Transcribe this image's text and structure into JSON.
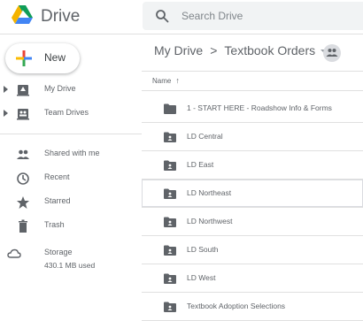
{
  "app": {
    "name": "Drive"
  },
  "search": {
    "placeholder": "Search Drive"
  },
  "sidebar": {
    "new_label": "New",
    "items": [
      {
        "label": "My Drive",
        "icon": "my-drive-icon",
        "expandable": true
      },
      {
        "label": "Team Drives",
        "icon": "team-drives-icon",
        "expandable": true
      },
      {
        "label": "Shared with me",
        "icon": "shared-with-me-icon"
      },
      {
        "label": "Recent",
        "icon": "recent-icon"
      },
      {
        "label": "Starred",
        "icon": "star-icon"
      },
      {
        "label": "Trash",
        "icon": "trash-icon"
      },
      {
        "label": "Storage",
        "icon": "cloud-icon"
      }
    ],
    "storage_used": "430.1 MB used"
  },
  "breadcrumb": {
    "root": "My Drive",
    "separator": ">",
    "current": "Textbook Orders"
  },
  "list": {
    "column_header": "Name",
    "sort_icon": "arrow-up-icon",
    "files": [
      {
        "name": "1 - START HERE - Roadshow Info & Forms",
        "type": "folder",
        "selected": false
      },
      {
        "name": "LD Central",
        "type": "folder",
        "selected": false
      },
      {
        "name": "LD East",
        "type": "folder",
        "selected": false
      },
      {
        "name": "LD Northeast",
        "type": "folder",
        "selected": true
      },
      {
        "name": "LD Northwest",
        "type": "folder",
        "selected": false
      },
      {
        "name": "LD South",
        "type": "folder",
        "selected": false
      },
      {
        "name": "LD West",
        "type": "folder",
        "selected": false
      },
      {
        "name": "Textbook Adoption Selections",
        "type": "folder",
        "selected": false
      }
    ]
  },
  "colors": {
    "icon_gray": "#5f6368",
    "folder_gray": "#5f6368",
    "drive_blue": "#4285f4",
    "drive_green": "#0f9d58",
    "drive_yellow": "#f4b400",
    "plus_red": "#ea4335"
  }
}
